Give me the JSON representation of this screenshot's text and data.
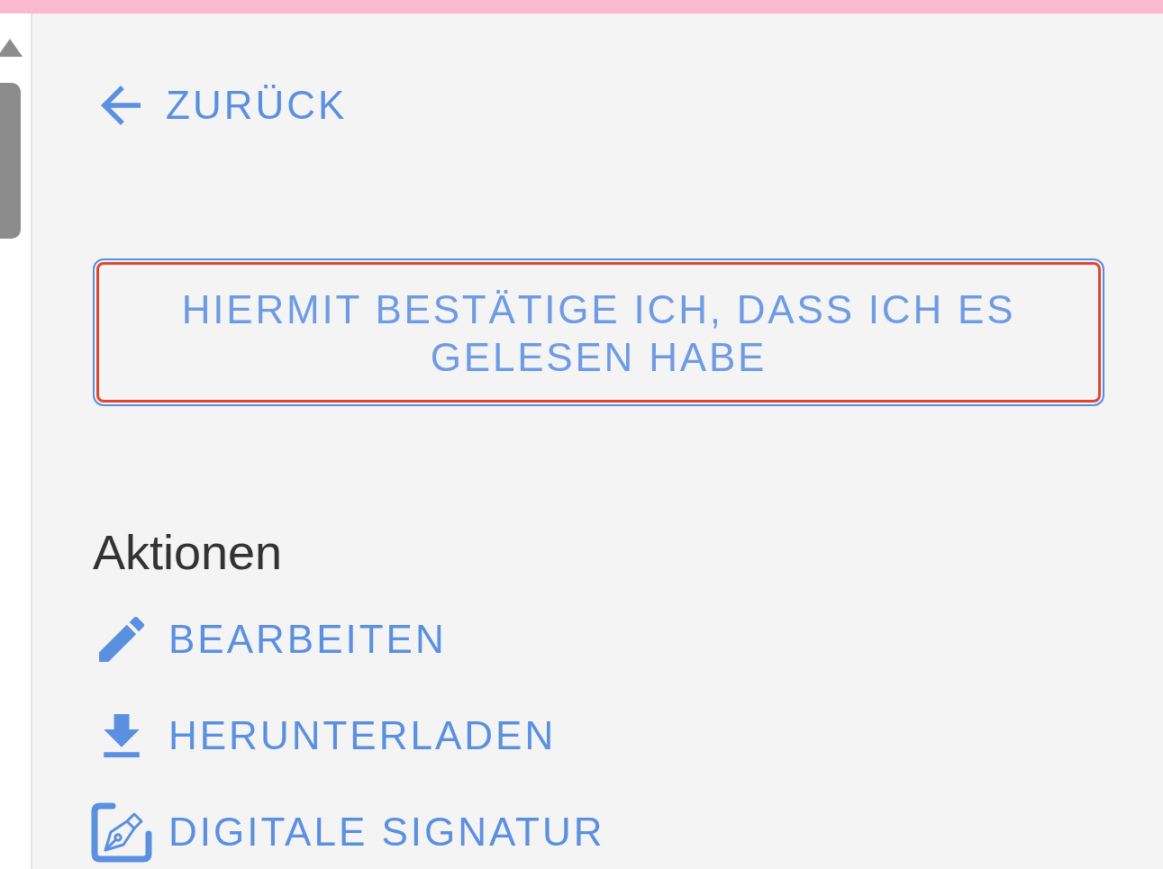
{
  "back_link": {
    "label": "ZURÜCK"
  },
  "confirm_button": {
    "label": "HIERMIT BESTÄTIGE ICH, DASS ICH ES GELESEN HABE",
    "focused": true
  },
  "actions": {
    "title": "Aktionen",
    "items": [
      {
        "kind": "edit",
        "label": "BEARBEITEN"
      },
      {
        "kind": "download",
        "label": "HERUNTERLADEN"
      },
      {
        "kind": "signature",
        "label": "DIGITALE SIGNATUR"
      }
    ]
  }
}
